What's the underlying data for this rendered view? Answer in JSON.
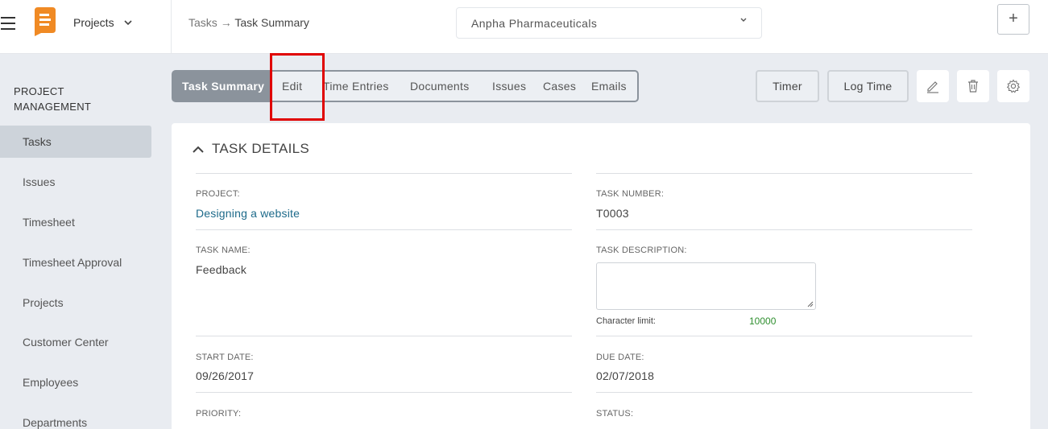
{
  "header": {
    "module": "Projects",
    "breadcrumb": {
      "parent": "Tasks",
      "arrow": "→",
      "current": "Task Summary"
    },
    "company": "Anpha Pharmaceuticals",
    "plus_label": "+"
  },
  "sidebar": {
    "title": "PROJECT MANAGEMENT",
    "items": [
      {
        "label": "Tasks"
      },
      {
        "label": "Issues"
      },
      {
        "label": "Timesheet"
      },
      {
        "label": "Timesheet Approval"
      },
      {
        "label": "Projects"
      },
      {
        "label": "Customer Center"
      },
      {
        "label": "Employees"
      },
      {
        "label": "Departments"
      }
    ]
  },
  "tabs": [
    {
      "label": "Task Summary"
    },
    {
      "label": "Edit"
    },
    {
      "label": "Time Entries"
    },
    {
      "label": "Documents"
    },
    {
      "label": "Issues"
    },
    {
      "label": "Cases"
    },
    {
      "label": "Emails"
    }
  ],
  "actions": {
    "timer": "Timer",
    "log_time": "Log Time"
  },
  "details": {
    "heading": "TASK DETAILS",
    "project_label": "PROJECT:",
    "project_value": "Designing a website",
    "task_number_label": "TASK NUMBER:",
    "task_number_value": "T0003",
    "task_name_label": "TASK NAME:",
    "task_name_value": "Feedback",
    "task_description_label": "TASK DESCRIPTION:",
    "char_limit_label": "Character limit:",
    "char_limit_value": "10000",
    "start_date_label": "START DATE:",
    "start_date_value": "09/26/2017",
    "due_date_label": "DUE DATE:",
    "due_date_value": "02/07/2018",
    "priority_label": "PRIORITY:",
    "status_label": "STATUS:"
  },
  "colors": {
    "accent_orange": "#f08a24",
    "tab_active_bg": "#8b939c",
    "link": "#1d6a8a",
    "char_limit_green": "#2f8f2f",
    "highlight_red": "#e00000"
  },
  "icons": {
    "menu": "hamburger-icon",
    "logo": "app-logo",
    "edit": "pencil-icon",
    "delete": "trash-icon",
    "settings": "gear-icon",
    "collapse": "chevron-up-icon"
  }
}
